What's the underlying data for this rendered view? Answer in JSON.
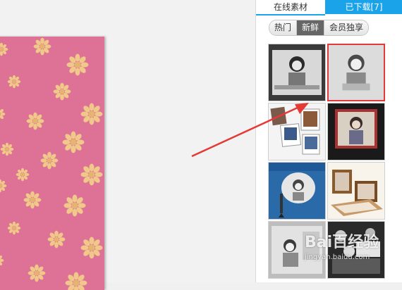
{
  "tabs": [
    {
      "label": "在线素材"
    },
    {
      "label": "已下载[7]"
    }
  ],
  "filters": [
    {
      "label": "热门"
    },
    {
      "label": "新鲜"
    },
    {
      "label": "会员独享"
    }
  ],
  "watermark": {
    "brand": "Bai百经验",
    "url": "jingyan.baidu.com"
  },
  "colors": {
    "accent": "#1aa3e8",
    "paper": "#dd7296",
    "flower": "#f0c889",
    "selection": "#e4393c"
  }
}
